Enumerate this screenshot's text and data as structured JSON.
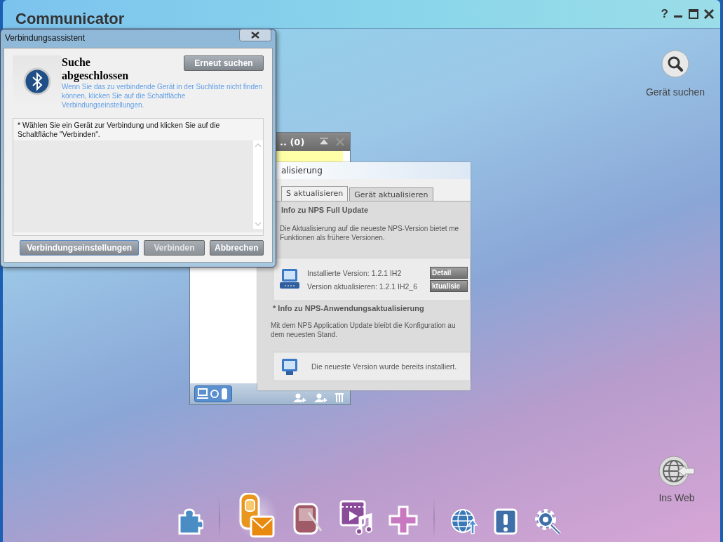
{
  "window": {
    "title": "Communicator",
    "help": "?"
  },
  "side_actions": [
    {
      "kind": "search",
      "label": "Gerät suchen"
    },
    {
      "kind": "web",
      "label": "Ins Web"
    }
  ],
  "contacts_window": {
    "title": ".. (0)"
  },
  "update_window": {
    "title": "alisierung",
    "tabs": [
      {
        "label": "S aktualisieren",
        "selected": true
      },
      {
        "label": "Gerät aktualisieren",
        "selected": false
      }
    ],
    "full_update": {
      "heading": "Info zu NPS Full Update",
      "description_lines": [
        "Die Aktualisierung auf die neueste NPS-Version bietet me",
        "Funktionen als frühere Versionen."
      ],
      "installed": "Installierte Version: 1.2.1 IH2",
      "available": "Version aktualisieren: 1.2.1 IH2_6",
      "buttons": [
        "Detail",
        "ktualisie"
      ]
    },
    "app_update": {
      "heading": "* Info zu NPS-Anwendungsaktualisierung",
      "description_lines": [
        "Mit dem NPS Application Update bleibt die Konfiguration au",
        "dem neuesten Stand."
      ],
      "status": "Die neueste Version wurde bereits installiert."
    }
  },
  "dialog": {
    "title": "Verbindungsassistent",
    "heading": "Suche abgeschlossen",
    "rescan_button": "Erneut suchen",
    "hint": "Wenn Sie das zu verbindende Gerät in der Suchliste nicht finden können, klicken Sie auf die Schaltfläche Verbindungseinstellungen.",
    "instruction": "* Wählen Sie ein Gerät zur Verbindung und klicken Sie auf die Schaltfläche \"Verbinden\".",
    "buttons": [
      {
        "label": "Verbindungseinstellungen",
        "disabled": false
      },
      {
        "label": "Verbinden",
        "disabled": true
      },
      {
        "label": "Abbrechen",
        "disabled": false
      }
    ]
  },
  "dock": [
    {
      "kind": "puzzle",
      "selected": false
    },
    {
      "kind": "message",
      "selected": true
    },
    {
      "kind": "pda",
      "selected": false
    },
    {
      "kind": "media",
      "selected": false
    },
    {
      "kind": "plus",
      "selected": false
    },
    {
      "kind": "globe",
      "selected": false
    },
    {
      "kind": "alert",
      "selected": false
    },
    {
      "kind": "settings",
      "selected": false
    }
  ]
}
